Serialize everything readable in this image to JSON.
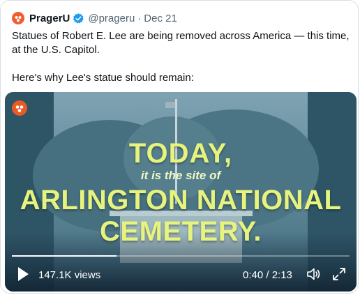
{
  "tweet": {
    "author_name": "PragerU",
    "handle": "@prageru",
    "separator": "·",
    "date": "Dec 21",
    "text_line1": "Statues of Robert E. Lee are being removed across America — this time, at the U.S. Capitol.",
    "text_line2": "Here's why Lee's statue should remain:"
  },
  "video": {
    "overlay_today": "TODAY,",
    "overlay_sub": "it is the site of",
    "overlay_line1": "ARLINGTON NATIONAL",
    "overlay_line2": "CEMETERY.",
    "views": "147.1K views",
    "time": "0:40 / 2:13",
    "progress_fraction": 0.31
  },
  "colors": {
    "brand": "#f25d2e",
    "verified": "#1d9bf0",
    "overlay_text": "#e6f47e"
  },
  "icons": [
    "avatar-logo-icon",
    "verified-icon",
    "play-icon",
    "volume-icon",
    "fullscreen-icon"
  ]
}
